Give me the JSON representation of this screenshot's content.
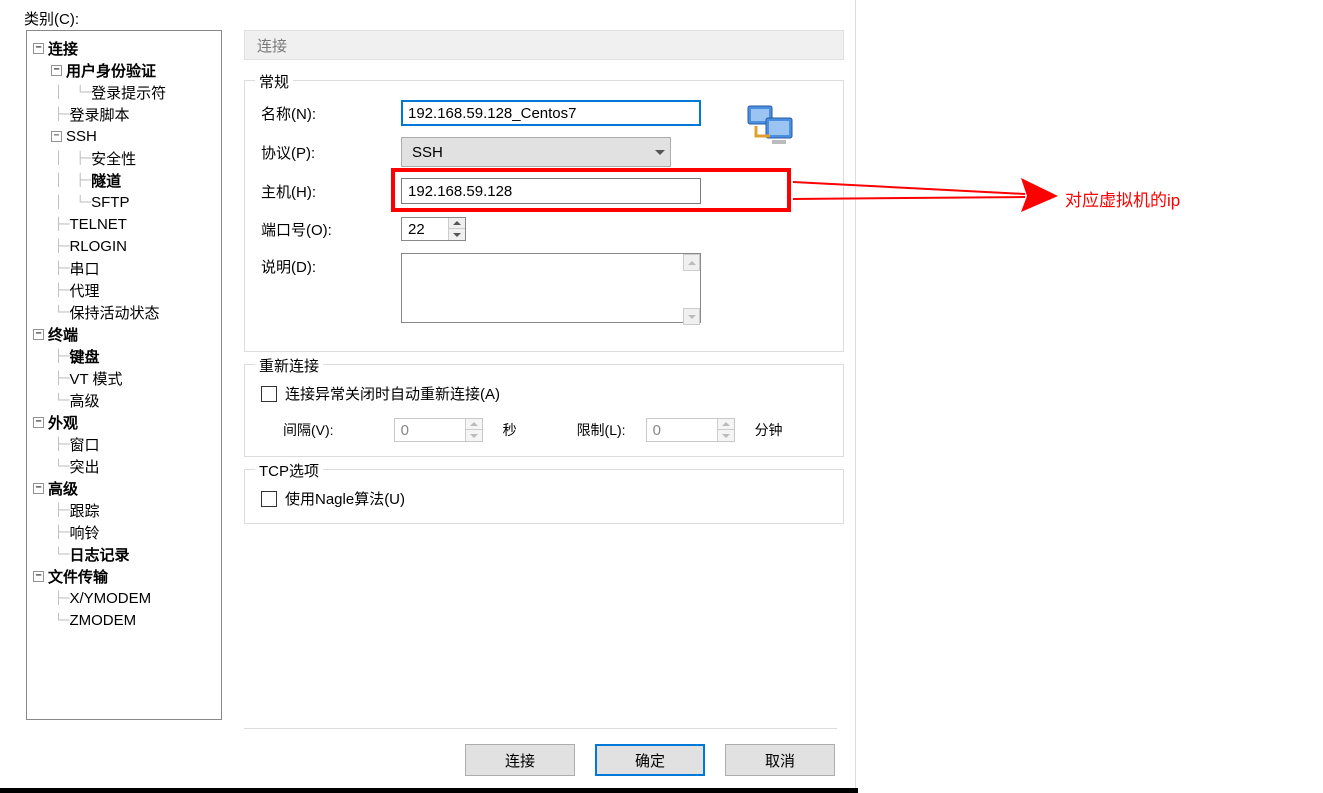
{
  "category_label": "类别(C):",
  "tree": {
    "connection": "连接",
    "user_auth": "用户身份验证",
    "login_prompt": "登录提示符",
    "login_script": "登录脚本",
    "ssh": "SSH",
    "security": "安全性",
    "tunnel": "隧道",
    "sftp": "SFTP",
    "telnet": "TELNET",
    "rlogin": "RLOGIN",
    "serial": "串口",
    "proxy": "代理",
    "keep_alive": "保持活动状态",
    "terminal": "终端",
    "keyboard": "键盘",
    "vt_mode": "VT 模式",
    "advanced_term": "高级",
    "appearance": "外观",
    "window": "窗口",
    "highlight": "突出",
    "advanced": "高级",
    "trace": "跟踪",
    "bell": "响铃",
    "logging": "日志记录",
    "file_transfer": "文件传输",
    "xymodem": "X/YMODEM",
    "zmodem": "ZMODEM"
  },
  "panel_title": "连接",
  "groups": {
    "general": "常规",
    "reconnect": "重新连接",
    "tcp": "TCP选项"
  },
  "labels": {
    "name": "名称(N):",
    "protocol": "协议(P):",
    "host": "主机(H):",
    "port": "端口号(O):",
    "description": "说明(D):",
    "auto_reconnect": "连接异常关闭时自动重新连接(A)",
    "interval": "间隔(V):",
    "seconds": "秒",
    "limit": "限制(L):",
    "minutes": "分钟",
    "nagle": "使用Nagle算法(U)"
  },
  "values": {
    "name": "192.168.59.128_Centos7",
    "protocol": "SSH",
    "host": "192.168.59.128",
    "port": "22",
    "description": "",
    "interval": "0",
    "limit": "0"
  },
  "buttons": {
    "connect": "连接",
    "ok": "确定",
    "cancel": "取消"
  },
  "annotation": "对应虚拟机的ip"
}
